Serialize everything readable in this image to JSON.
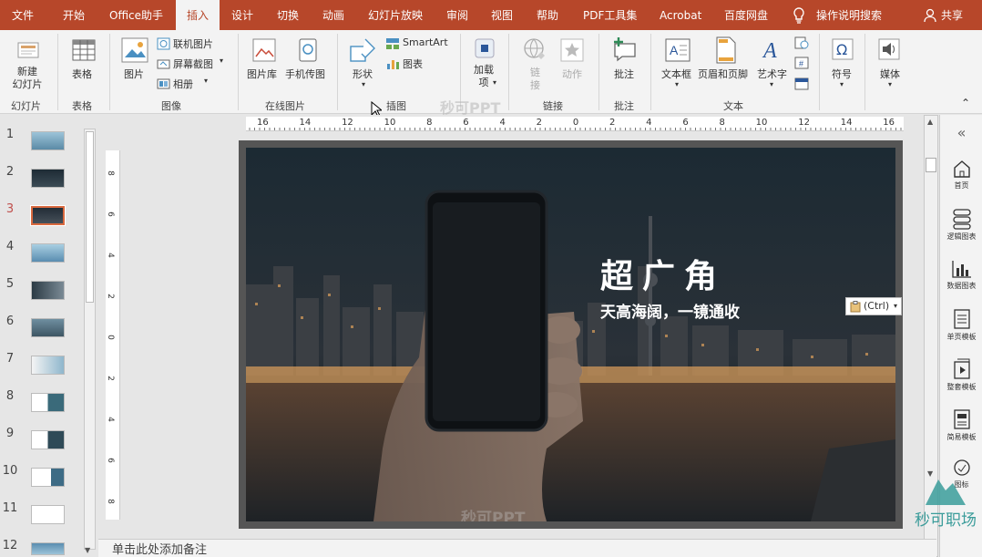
{
  "menubar": {
    "items": [
      "文件",
      "开始",
      "Office助手",
      "插入",
      "设计",
      "切换",
      "动画",
      "幻灯片放映",
      "审阅",
      "视图",
      "帮助",
      "PDF工具集",
      "Acrobat",
      "百度网盘"
    ],
    "tell_me": "操作说明搜索",
    "share": "共享",
    "active_index": 3
  },
  "ribbon": {
    "new_slide": "新建\n幻灯片",
    "table": "表格",
    "picture": "图片",
    "online_picture": "联机图片",
    "screenshot": "屏幕截图",
    "album": "相册",
    "gallery": "图片库",
    "phone_picture": "手机传图",
    "shapes": "形状",
    "smartart": "SmartArt",
    "chart": "图表",
    "addins": "加载\n项",
    "link": "链\n接",
    "action": "动作",
    "comment": "批注",
    "textbox": "文本框",
    "header_footer": "页眉和页脚",
    "wordart": "艺术字",
    "symbol": "符号",
    "media": "媒体",
    "groups": {
      "slides": "幻灯片",
      "tables": "表格",
      "images": "图像",
      "online_images": "在线图片",
      "illustrations": "插图",
      "links": "链接",
      "comments": "批注",
      "text": "文本"
    },
    "watermark": "秒可PPT"
  },
  "thumbnails": {
    "numbers": [
      "1",
      "2",
      "3",
      "4",
      "5",
      "6",
      "7",
      "8",
      "9",
      "10",
      "11",
      "12"
    ],
    "selected_index": 2
  },
  "ruler": {
    "h_labels": [
      "16",
      "14",
      "12",
      "10",
      "8",
      "6",
      "4",
      "2",
      "0",
      "2",
      "4",
      "6",
      "8",
      "10",
      "12",
      "14",
      "16"
    ],
    "v_labels": [
      "8",
      "6",
      "4",
      "2",
      "0",
      "2",
      "4",
      "6",
      "8"
    ]
  },
  "slide": {
    "title": "超广角",
    "subtitle": "天高海阔，一镜通收",
    "paste_option": "(Ctrl)",
    "watermark": "秒可PPT"
  },
  "notes": {
    "placeholder": "单击此处添加备注"
  },
  "right_panel": {
    "items": [
      "首页",
      "逻辑图表",
      "数据图表",
      "单页模板",
      "整套模板",
      "简易模板",
      "图标"
    ],
    "logo_text": "秒可职场"
  },
  "colors": {
    "accent": "#b7472a",
    "ribbon_bg": "#f3f3f3"
  }
}
